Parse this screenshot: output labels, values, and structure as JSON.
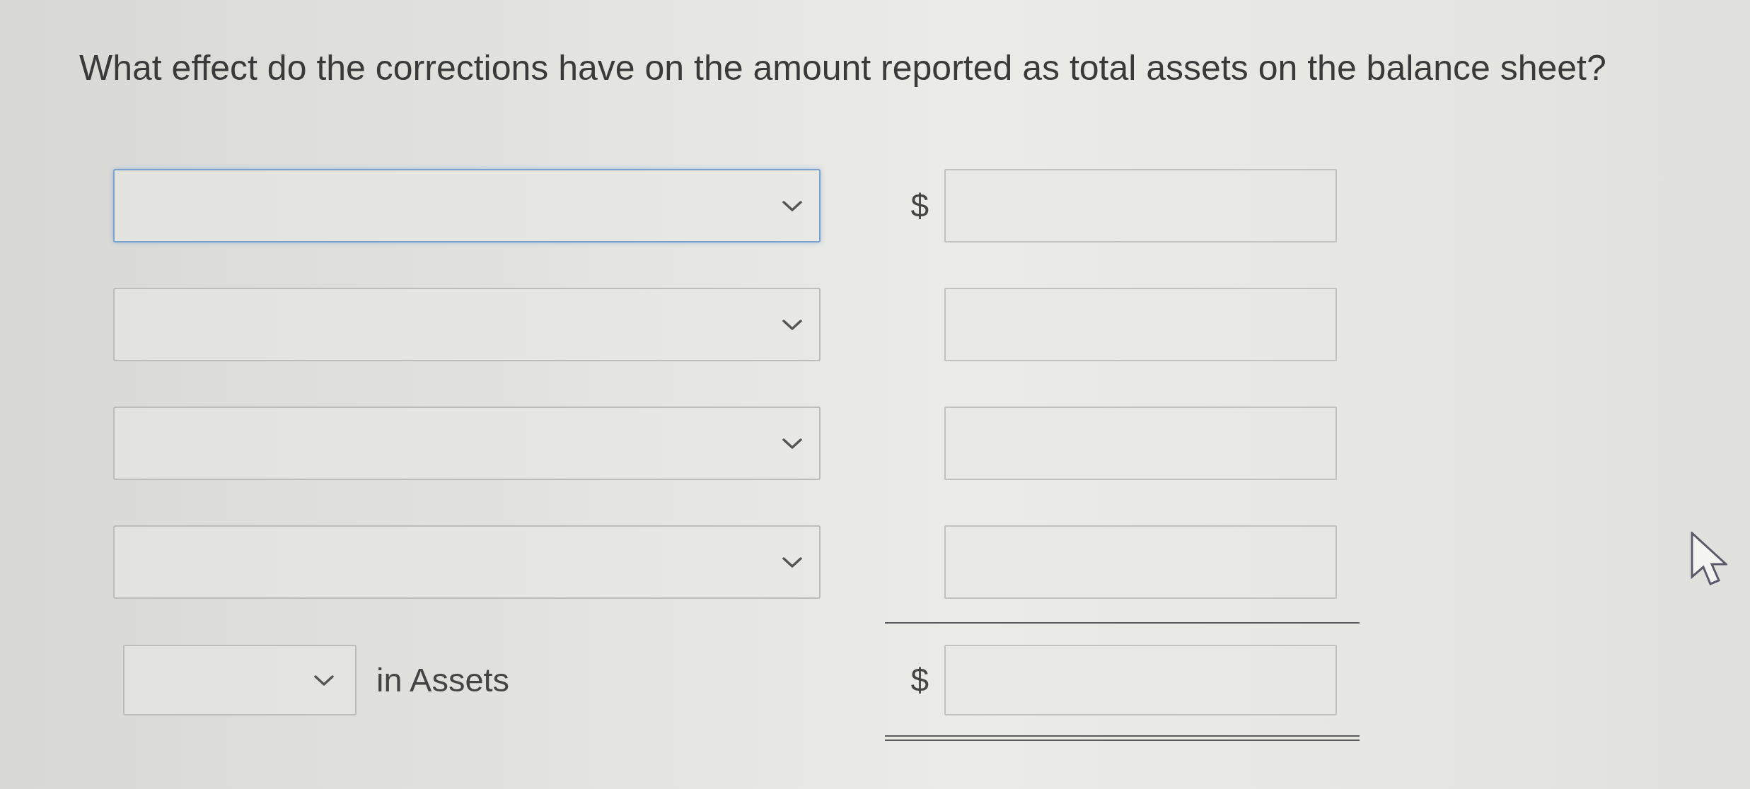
{
  "question": "What effect do the corrections have on the amount reported as total assets on the balance sheet?",
  "entries": [
    {
      "dropdown": {
        "focused": true
      },
      "currency": "$"
    },
    {
      "dropdown": {
        "focused": false
      }
    },
    {
      "dropdown": {
        "focused": false
      }
    },
    {
      "dropdown": {
        "focused": false
      }
    }
  ],
  "total": {
    "dropdown": {
      "focused": false
    },
    "label": "in Assets",
    "currency": "$"
  }
}
